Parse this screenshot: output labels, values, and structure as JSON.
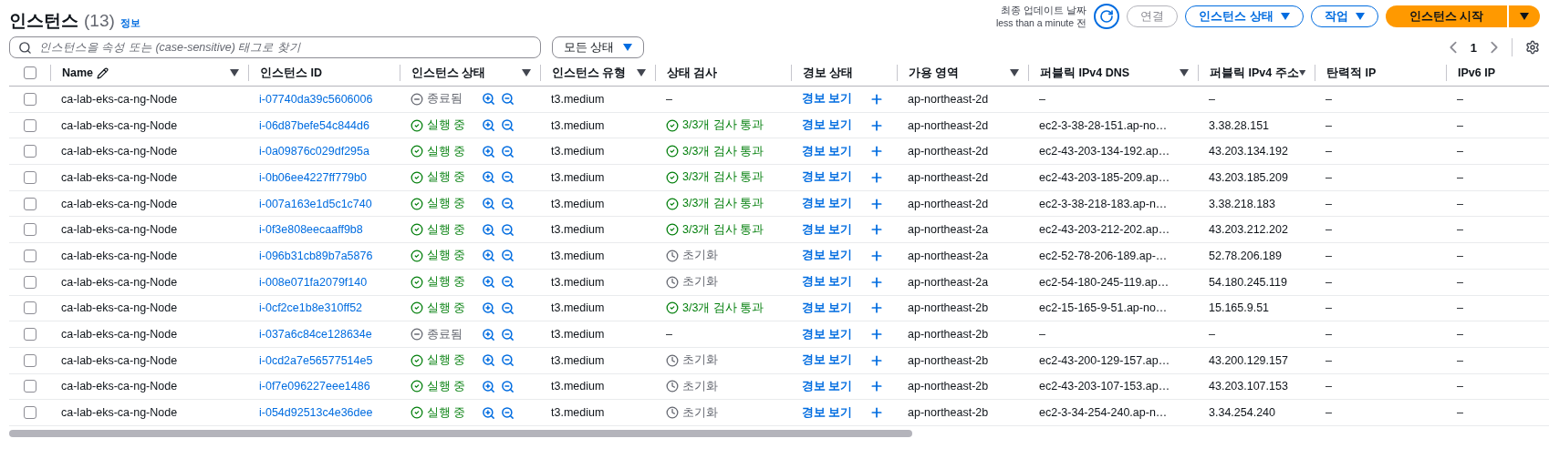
{
  "header": {
    "title": "인스턴스",
    "count": "(13)",
    "info_link": "정보",
    "last_updated_label": "최종 업데이트 날짜",
    "last_updated_value": "less than a minute 전",
    "buttons": [
      {
        "label": "연결",
        "kind": "disabled"
      },
      {
        "label": "인스턴스 상태",
        "kind": "dropdown"
      },
      {
        "label": "작업",
        "kind": "dropdown"
      }
    ],
    "primary_button": "인스턴스 시작"
  },
  "search": {
    "placeholder": "인스턴스을 속성 또는 (case-sensitive) 태그로 찾기"
  },
  "state_filter": "모든 상태",
  "pagination": {
    "page": "1"
  },
  "table": {
    "select_all_checked": false,
    "columns": [
      {
        "label": "Name",
        "sortable": true,
        "editable": true
      },
      {
        "label": "인스턴스 ID",
        "sortable": false,
        "editable": false
      },
      {
        "label": "인스턴스 상태",
        "sortable": true,
        "editable": false
      },
      {
        "label": "인스턴스 유형",
        "sortable": true,
        "editable": false
      },
      {
        "label": "상태 검사",
        "sortable": false,
        "editable": false
      },
      {
        "label": "경보 상태",
        "sortable": false,
        "editable": false
      },
      {
        "label": "가용 영역",
        "sortable": true,
        "editable": false
      },
      {
        "label": "퍼블릭 IPv4 DNS",
        "sortable": true,
        "editable": false
      },
      {
        "label": "퍼블릭 IPv4 주소",
        "sortable": true,
        "editable": false
      },
      {
        "label": "탄력적 IP",
        "sortable": false,
        "editable": false
      },
      {
        "label": "IPv6 IP",
        "sortable": false,
        "editable": false
      }
    ],
    "rows": [
      {
        "checked": false,
        "name": "ca-lab-eks-ca-ng-Node",
        "id": "i-07740da39c5606006",
        "state": {
          "kind": "terminated",
          "label": "종료됨"
        },
        "type": "t3.medium",
        "check": {
          "kind": "none",
          "label": "–"
        },
        "alarm": "경보 보기",
        "az": "ap-northeast-2d",
        "dns": "–",
        "ipv4": "–",
        "eip": "–",
        "ipv6": "–"
      },
      {
        "checked": false,
        "name": "ca-lab-eks-ca-ng-Node",
        "id": "i-06d87befe54c844d6",
        "state": {
          "kind": "running",
          "label": "실행 중"
        },
        "type": "t3.medium",
        "check": {
          "kind": "passed",
          "label": "3/3개 검사 통과"
        },
        "alarm": "경보 보기",
        "az": "ap-northeast-2d",
        "dns": "ec2-3-38-28-151.ap-no…",
        "ipv4": "3.38.28.151",
        "eip": "–",
        "ipv6": "–"
      },
      {
        "checked": false,
        "name": "ca-lab-eks-ca-ng-Node",
        "id": "i-0a09876c029df295a",
        "state": {
          "kind": "running",
          "label": "실행 중"
        },
        "type": "t3.medium",
        "check": {
          "kind": "passed",
          "label": "3/3개 검사 통과"
        },
        "alarm": "경보 보기",
        "az": "ap-northeast-2d",
        "dns": "ec2-43-203-134-192.ap…",
        "ipv4": "43.203.134.192",
        "eip": "–",
        "ipv6": "–"
      },
      {
        "checked": false,
        "name": "ca-lab-eks-ca-ng-Node",
        "id": "i-0b06ee4227ff779b0",
        "state": {
          "kind": "running",
          "label": "실행 중"
        },
        "type": "t3.medium",
        "check": {
          "kind": "passed",
          "label": "3/3개 검사 통과"
        },
        "alarm": "경보 보기",
        "az": "ap-northeast-2d",
        "dns": "ec2-43-203-185-209.ap…",
        "ipv4": "43.203.185.209",
        "eip": "–",
        "ipv6": "–"
      },
      {
        "checked": false,
        "name": "ca-lab-eks-ca-ng-Node",
        "id": "i-007a163e1d5c1c740",
        "state": {
          "kind": "running",
          "label": "실행 중"
        },
        "type": "t3.medium",
        "check": {
          "kind": "passed",
          "label": "3/3개 검사 통과"
        },
        "alarm": "경보 보기",
        "az": "ap-northeast-2d",
        "dns": "ec2-3-38-218-183.ap-n…",
        "ipv4": "3.38.218.183",
        "eip": "–",
        "ipv6": "–"
      },
      {
        "checked": false,
        "name": "ca-lab-eks-ca-ng-Node",
        "id": "i-0f3e808eecaaff9b8",
        "state": {
          "kind": "running",
          "label": "실행 중"
        },
        "type": "t3.medium",
        "check": {
          "kind": "passed",
          "label": "3/3개 검사 통과"
        },
        "alarm": "경보 보기",
        "az": "ap-northeast-2a",
        "dns": "ec2-43-203-212-202.ap…",
        "ipv4": "43.203.212.202",
        "eip": "–",
        "ipv6": "–"
      },
      {
        "checked": false,
        "name": "ca-lab-eks-ca-ng-Node",
        "id": "i-096b31cb89b7a5876",
        "state": {
          "kind": "running",
          "label": "실행 중"
        },
        "type": "t3.medium",
        "check": {
          "kind": "initializing",
          "label": "초기화"
        },
        "alarm": "경보 보기",
        "az": "ap-northeast-2a",
        "dns": "ec2-52-78-206-189.ap-…",
        "ipv4": "52.78.206.189",
        "eip": "–",
        "ipv6": "–"
      },
      {
        "checked": false,
        "name": "ca-lab-eks-ca-ng-Node",
        "id": "i-008e071fa2079f140",
        "state": {
          "kind": "running",
          "label": "실행 중"
        },
        "type": "t3.medium",
        "check": {
          "kind": "initializing",
          "label": "초기화"
        },
        "alarm": "경보 보기",
        "az": "ap-northeast-2a",
        "dns": "ec2-54-180-245-119.ap…",
        "ipv4": "54.180.245.119",
        "eip": "–",
        "ipv6": "–"
      },
      {
        "checked": false,
        "name": "ca-lab-eks-ca-ng-Node",
        "id": "i-0cf2ce1b8e310ff52",
        "state": {
          "kind": "running",
          "label": "실행 중"
        },
        "type": "t3.medium",
        "check": {
          "kind": "passed",
          "label": "3/3개 검사 통과"
        },
        "alarm": "경보 보기",
        "az": "ap-northeast-2b",
        "dns": "ec2-15-165-9-51.ap-no…",
        "ipv4": "15.165.9.51",
        "eip": "–",
        "ipv6": "–"
      },
      {
        "checked": false,
        "name": "ca-lab-eks-ca-ng-Node",
        "id": "i-037a6c84ce128634e",
        "state": {
          "kind": "terminated",
          "label": "종료됨"
        },
        "type": "t3.medium",
        "check": {
          "kind": "none",
          "label": "–"
        },
        "alarm": "경보 보기",
        "az": "ap-northeast-2b",
        "dns": "–",
        "ipv4": "–",
        "eip": "–",
        "ipv6": "–"
      },
      {
        "checked": false,
        "name": "ca-lab-eks-ca-ng-Node",
        "id": "i-0cd2a7e56577514e5",
        "state": {
          "kind": "running",
          "label": "실행 중"
        },
        "type": "t3.medium",
        "check": {
          "kind": "initializing",
          "label": "초기화"
        },
        "alarm": "경보 보기",
        "az": "ap-northeast-2b",
        "dns": "ec2-43-200-129-157.ap…",
        "ipv4": "43.200.129.157",
        "eip": "–",
        "ipv6": "–"
      },
      {
        "checked": false,
        "name": "ca-lab-eks-ca-ng-Node",
        "id": "i-0f7e096227eee1486",
        "state": {
          "kind": "running",
          "label": "실행 중"
        },
        "type": "t3.medium",
        "check": {
          "kind": "initializing",
          "label": "초기화"
        },
        "alarm": "경보 보기",
        "az": "ap-northeast-2b",
        "dns": "ec2-43-203-107-153.ap…",
        "ipv4": "43.203.107.153",
        "eip": "–",
        "ipv6": "–"
      },
      {
        "checked": false,
        "name": "ca-lab-eks-ca-ng-Node",
        "id": "i-054d92513c4e36dee",
        "state": {
          "kind": "running",
          "label": "실행 중"
        },
        "type": "t3.medium",
        "check": {
          "kind": "initializing",
          "label": "초기화"
        },
        "alarm": "경보 보기",
        "az": "ap-northeast-2b",
        "dns": "ec2-3-34-254-240.ap-n…",
        "ipv4": "3.34.254.240",
        "eip": "–",
        "ipv6": "–"
      }
    ]
  }
}
